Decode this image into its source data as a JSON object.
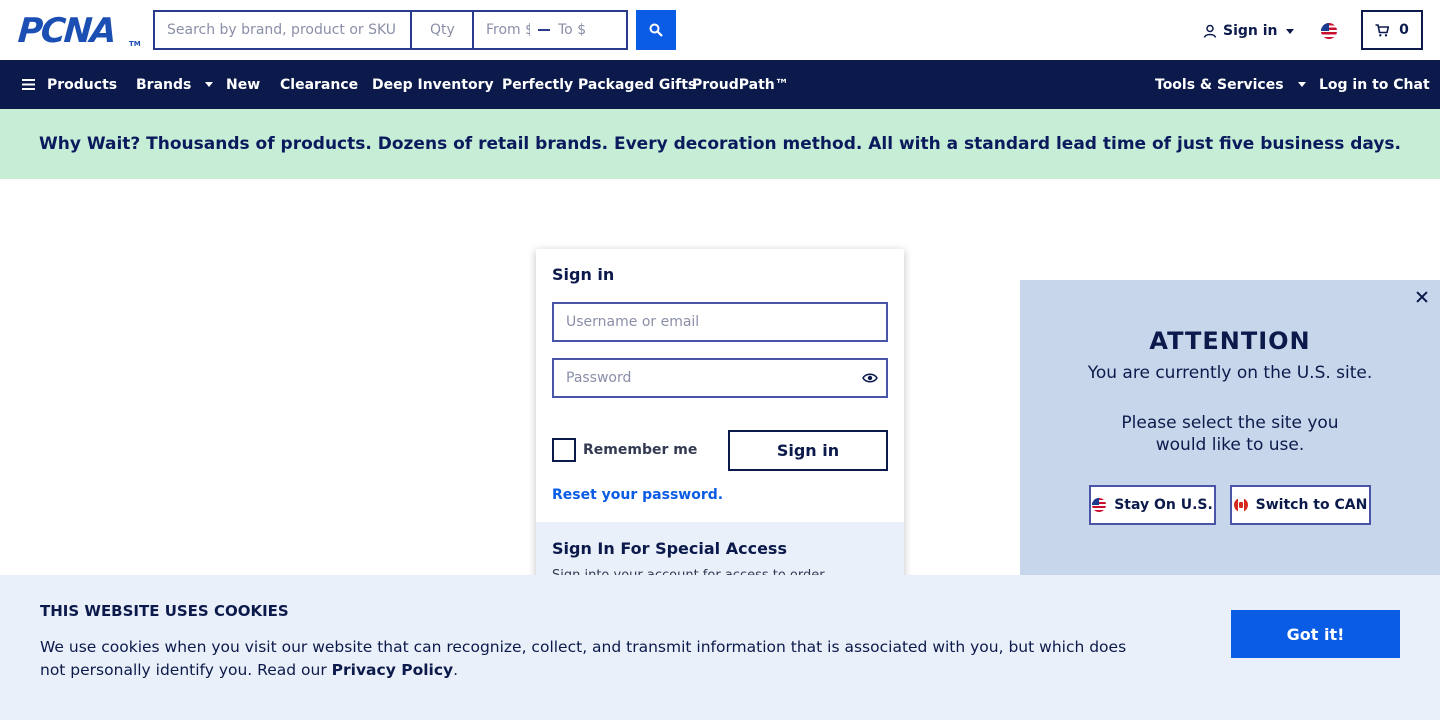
{
  "header": {
    "logo_text": "PCNA",
    "logo_tm": "TM",
    "search_placeholder": "Search by brand, product or SKU",
    "qty_placeholder": "Qty",
    "price_from_placeholder": "From $",
    "price_to_placeholder": "To $",
    "signin_label": "Sign in",
    "cart_count": "0"
  },
  "nav": {
    "items": [
      {
        "label": "Products"
      },
      {
        "label": "Brands"
      },
      {
        "label": "New"
      },
      {
        "label": "Clearance"
      },
      {
        "label": "Deep Inventory"
      },
      {
        "label": "Perfectly Packaged Gifts"
      },
      {
        "label": "ProudPath™"
      }
    ],
    "tools_label": "Tools & Services",
    "chat_label": "Log in to Chat"
  },
  "promo": {
    "text": "Why Wait? Thousands of products. Dozens of retail brands. Every decoration method. All with a standard lead time of just five business days."
  },
  "signin_card": {
    "title": "Sign in",
    "username_placeholder": "Username or email",
    "password_placeholder": "Password",
    "remember_label": "Remember me",
    "signin_button": "Sign in",
    "reset_link": "Reset your password.",
    "special_title": "Sign In For Special Access",
    "special_subtitle": "Sign into your account for access to order"
  },
  "attention": {
    "title": "ATTENTION",
    "line1": "You are currently on the U.S. site.",
    "line2": "Please select the site you would like to use.",
    "stay_button": "Stay On U.S.",
    "switch_button": "Switch to CAN"
  },
  "cookie": {
    "title": "THIS WEBSITE USES COOKIES",
    "text": "We use cookies when you visit our website that can recognize, collect, and transmit information that is associated with you, but which does not personally identify you. Read our ",
    "policy_link": "Privacy Policy",
    "text_end": ".",
    "button": "Got it!"
  },
  "colors": {
    "navy": "#0b1a4a",
    "accent_blue": "#0a5ce5",
    "promo_bg": "#c6eed6",
    "attention_bg": "#c8d6ec",
    "cookie_bg": "#eaf0fa"
  }
}
